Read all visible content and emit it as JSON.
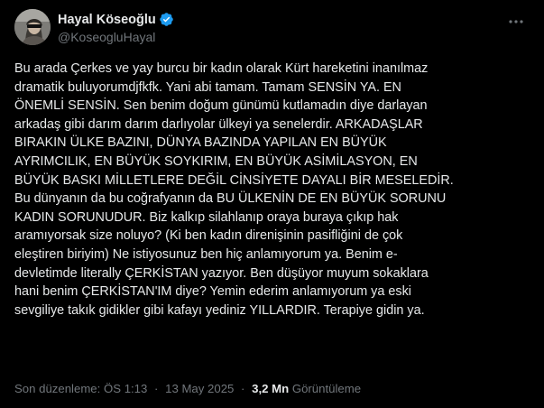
{
  "author": {
    "display_name": "Hayal Köseoğlu",
    "handle": "@KoseogluHayal",
    "verified": true,
    "avatar_icon": "profile-photo",
    "verified_icon": "verified-badge-icon",
    "verified_color": "#1d9bf0"
  },
  "menu": {
    "more_icon": "more-horizontal-icon"
  },
  "tweet": {
    "lines": [
      "Bu arada Çerkes ve yay burcu bir kadın olarak Kürt hareketini inanılmaz",
      "dramatik buluyorumdjfkfk. Yani abi tamam. Tamam SENSİN YA. EN",
      "ÖNEMLİ SENSİN. Sen benim doğum günümü kutlamadın diye darlayan",
      "arkadaş gibi darım darım darlıyolar ülkeyi ya senelerdir. ARKADAŞLAR",
      "BIRAKIN ÜLKE BAZINI,  DÜNYA BAZINDA YAPILAN EN BÜYÜK",
      "AYRIMCILIK, EN BÜYÜK SOYKIRIM, EN BÜYÜK ASİMİLASYON, EN",
      "BÜYÜK BASKI MİLLETLERE DEĞİL CİNSİYETE DAYALI BİR MESELEDİR.",
      "Bu dünyanın da  bu coğrafyanın da BU ÜLKENİN DE EN BÜYÜK SORUNU",
      "KADIN SORUNUDUR. Biz kalkıp silahlanıp oraya buraya çıkıp hak",
      "aramıyorsak size noluyo? (Ki ben kadın direnişinin pasifliğini de çok",
      "eleştiren biriyim) Ne istiyosunuz ben hiç anlamıyorum ya. Benim e-",
      "devletimde literally ÇERKİSTAN yazıyor. Ben düşüyor muyum sokaklara",
      "hani benim ÇERKİSTAN'IM diye? Yemin ederim anlamıyorum ya eski",
      "sevgiliye takık gidikler gibi kafayı yediniz YILLARDIR. Terapiye gidin ya."
    ]
  },
  "meta": {
    "edited_label": "Son düzenleme: ÖS 1:13",
    "separator": "·",
    "date": "13 May 2025",
    "views_count": "3,2 Mn",
    "views_label": "Görüntüleme"
  }
}
